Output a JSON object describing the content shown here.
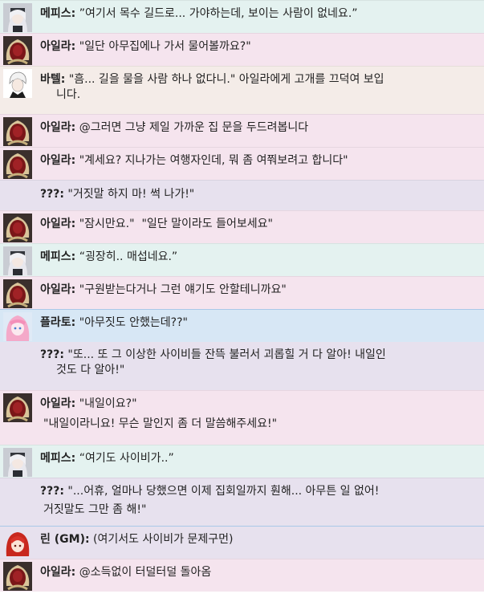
{
  "colors": {
    "mephis": "#e4f2f0",
    "ayla": "#f5e4ee",
    "batel": "#f4ece8",
    "unknown": "#e7e1ee",
    "plato": "#d7e7f5",
    "rin": "#e7e1ee",
    "divider_blue": "#a9c8e8"
  },
  "messages": [
    {
      "speaker": "메피스:",
      "text": "”여기서 목수 길드로... 가야하는데, 보이는 사람이 없네요.”",
      "avatar": "mephis-avatar-icon"
    },
    {
      "speaker": "아일라:",
      "text": "\"일단 아무집에나 가서 물어볼까요?\"",
      "avatar": "ayla-avatar-icon"
    },
    {
      "speaker": "바텔:",
      "text": "\"흠... 길을 물을 사람 하나 없다니.\" 아일라에게 고개를 끄덕여 보입",
      "text2": "니다.",
      "avatar": "batel-avatar-icon"
    },
    {
      "speaker": "아일라:",
      "text": "@그러면 그냥 제일 가까운 집 문을 두드려봅니다",
      "avatar": "ayla-avatar-icon"
    },
    {
      "speaker": "아일라:",
      "text": "\"계세요? 지나가는 여행자인데, 뭐 좀 여쭤보려고 합니다\"",
      "avatar": "ayla-avatar-icon"
    },
    {
      "speaker": "???:",
      "text": "\"거짓말 하지 마! 썩 나가!\""
    },
    {
      "speaker": "아일라:",
      "text": "\"잠시만요.\"  \"일단 말이라도 들어보세요\"",
      "avatar": "ayla-avatar-icon"
    },
    {
      "speaker": "메피스:",
      "text": "“굉장히.. 매섭네요.”",
      "avatar": "mephis-avatar-icon"
    },
    {
      "speaker": "아일라:",
      "text": "\"구원받는다거나 그런 얘기도 안할테니까요\"",
      "avatar": "ayla-avatar-icon"
    },
    {
      "speaker": "플라토:",
      "text": "\"아무짓도 안했는데??\"",
      "avatar": "plato-avatar-icon",
      "sub_speaker": "???:",
      "sub_text": "\"또... 또 그 이상한 사이비들 잔뜩 불러서 괴롭힐 거 다 알아! 내일인",
      "sub_text2": "것도 다 알아!\""
    },
    {
      "speaker": "아일라:",
      "text": "\"내일이요?\"",
      "avatar": "ayla-avatar-icon",
      "text_line2": "\"내일이라니요! 무슨 말인지 좀 더 말씀해주세요!\""
    },
    {
      "speaker": "메피스:",
      "text": "“여기도 사이비가..”",
      "avatar": "mephis-avatar-icon"
    },
    {
      "speaker": "???:",
      "text": "\"...어휴, 얼마나 당했으면 이제 집회일까지 훤해... 아무튼 일 없어!",
      "text2": "거짓말도 그만 좀 해!\""
    },
    {
      "speaker": "린 (GM):",
      "text": "(여기서도 사이비가 문제구먼)",
      "avatar": "rin-avatar-icon"
    },
    {
      "speaker": "아일라:",
      "text": "@소득없이 터덜터덜 돌아옴",
      "avatar": "ayla-avatar-icon"
    }
  ]
}
